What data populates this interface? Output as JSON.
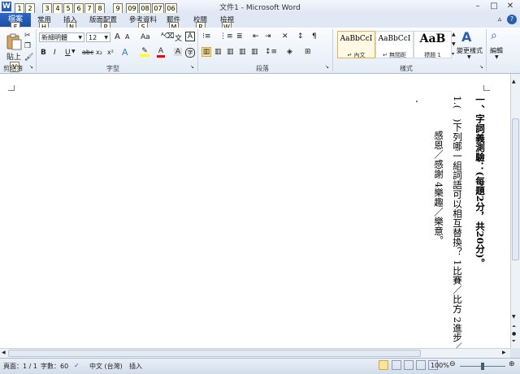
{
  "window": {
    "title": "文件1 - Microsoft Word",
    "app_icon": "W"
  },
  "qat_keytips": [
    "1",
    "2",
    "3",
    "4",
    "5",
    "6",
    "7",
    "8",
    "9",
    "09",
    "08",
    "07",
    "06"
  ],
  "ribbon_tabs": {
    "file": {
      "label": "檔案",
      "keytip": "F"
    },
    "tabs": [
      {
        "label": "常用",
        "keytip": "H"
      },
      {
        "label": "插入",
        "keytip": "N"
      },
      {
        "label": "版面配置",
        "keytip": "P"
      },
      {
        "label": "參考資料",
        "keytip": "S"
      },
      {
        "label": "郵件",
        "keytip": "M"
      },
      {
        "label": "校閱",
        "keytip": "R"
      },
      {
        "label": "檢視",
        "keytip": "W"
      }
    ]
  },
  "clipboard": {
    "paste_label": "貼上",
    "group_label": "剪貼簿"
  },
  "font": {
    "font_name": "新細明體",
    "font_size": "12",
    "bold": "B",
    "italic": "I",
    "underline": "U",
    "strike": "abc",
    "subscript": "x₂",
    "superscript": "x²",
    "grow": "A",
    "shrink": "A",
    "case": "Aa",
    "group_label": "字型"
  },
  "paragraph": {
    "group_label": "段落"
  },
  "styles": {
    "items": [
      {
        "sample": "AaBbCcI",
        "name": "↵ 內文"
      },
      {
        "sample": "AaBbCcI",
        "name": "↵ 無間距"
      },
      {
        "sample": "AaB",
        "name": "標題 1"
      }
    ],
    "change_label": "變更樣式",
    "group_label": "樣式"
  },
  "editing": {
    "label": "編輯"
  },
  "document": {
    "columns": [
      "一、字詞義測驗：(每題2分，共20分)。",
      "1.(　)下列哪一組詞語可以相互替換？ 1比賽／比方 2進步／",
      "感恩／感謝 4樂趣／樂意。"
    ]
  },
  "status": {
    "page": "頁面：1 / 1",
    "words": "字數：60",
    "language": "中文 (台灣)",
    "mode": "插入",
    "zoom": "100%",
    "zoom_level_percent": 100
  },
  "colors": {
    "accent": "#2a5db0",
    "ribbon": "#dfe8f4",
    "highlight": "#ffff00",
    "font_color": "#ff0000"
  }
}
